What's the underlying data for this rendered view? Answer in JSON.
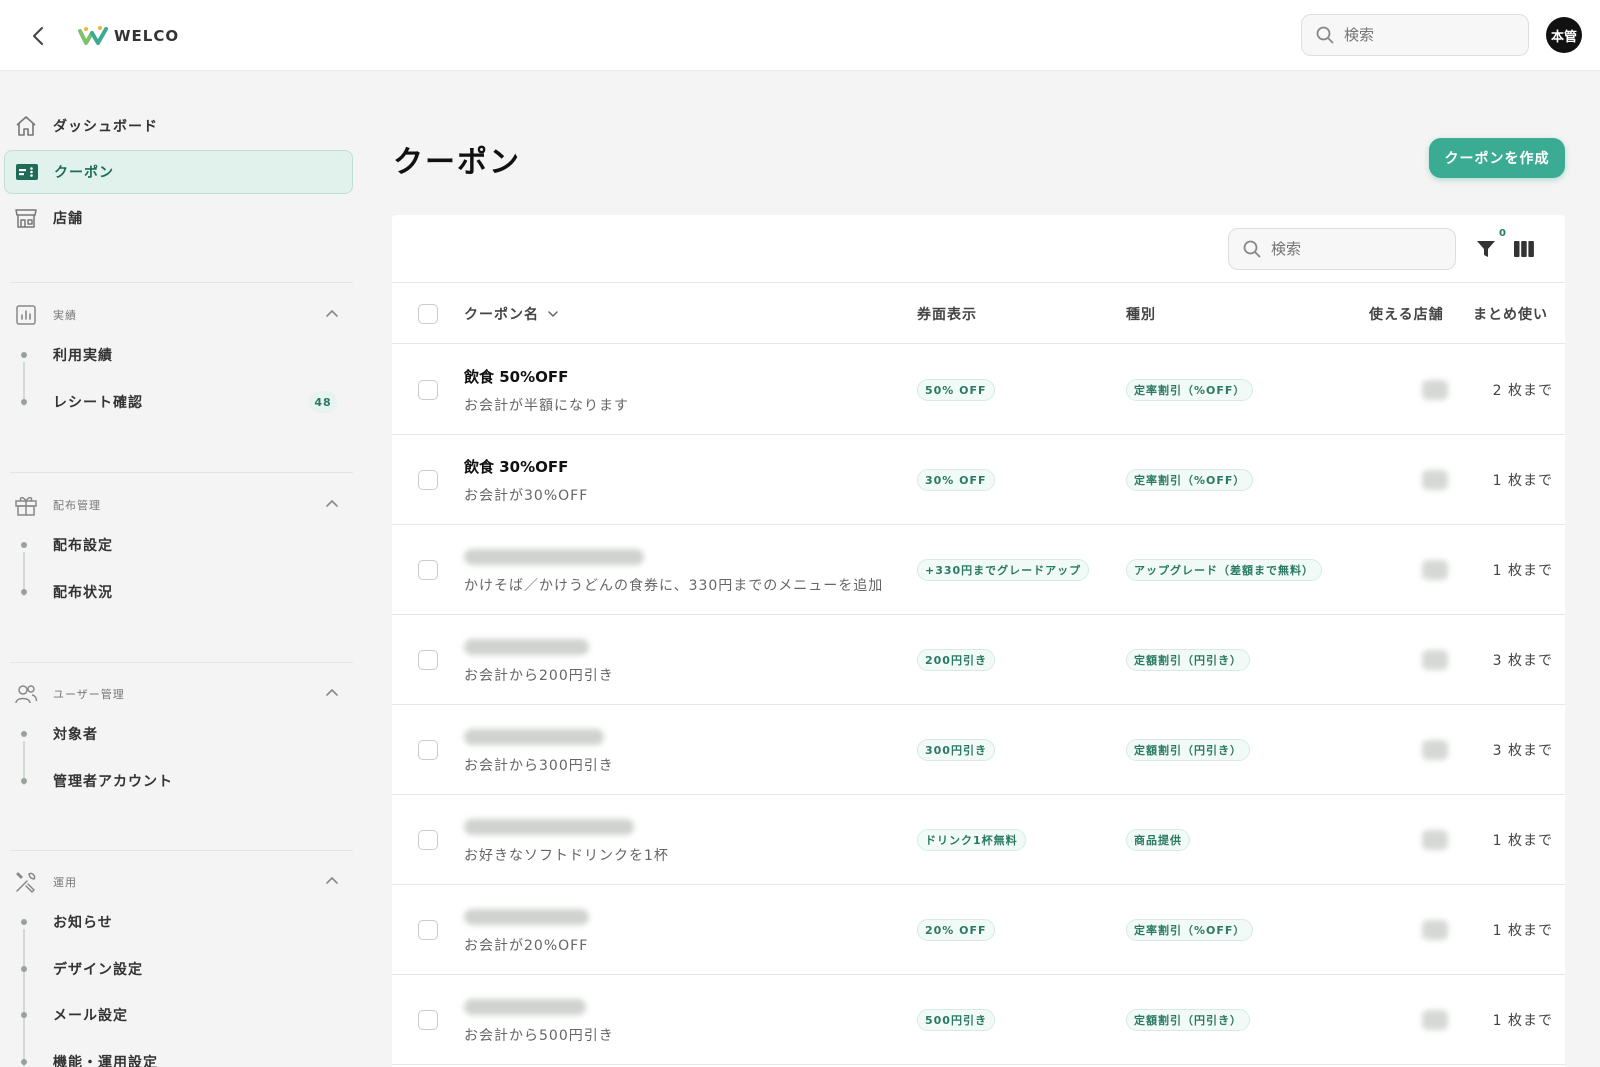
{
  "header": {
    "logo_text": "WELCO",
    "search_placeholder": "検索",
    "avatar_text": "本管"
  },
  "sidebar": {
    "top_items": [
      {
        "label": "ダッシュボード",
        "icon": "home-icon"
      },
      {
        "label": "クーポン",
        "icon": "ticket-icon",
        "active": true
      },
      {
        "label": "店舗",
        "icon": "store-icon"
      }
    ],
    "sections": [
      {
        "title": "実績",
        "icon": "chart-icon",
        "items": [
          {
            "label": "利用実績"
          },
          {
            "label": "レシート確認",
            "badge": "48"
          }
        ]
      },
      {
        "title": "配布管理",
        "icon": "gift-icon",
        "items": [
          {
            "label": "配布設定"
          },
          {
            "label": "配布状況"
          }
        ]
      },
      {
        "title": "ユーザー管理",
        "icon": "users-icon",
        "items": [
          {
            "label": "対象者"
          },
          {
            "label": "管理者アカウント"
          }
        ]
      },
      {
        "title": "運用",
        "icon": "tools-icon",
        "items": [
          {
            "label": "お知らせ"
          },
          {
            "label": "デザイン設定"
          },
          {
            "label": "メール設定"
          },
          {
            "label": "機能・運用設定"
          }
        ]
      }
    ]
  },
  "main": {
    "title": "クーポン",
    "create_button": "クーポンを作成",
    "search_placeholder": "検索",
    "filter_count": "0",
    "columns": {
      "name": "クーポン名",
      "face": "券面表示",
      "type": "種別",
      "stores": "使える店舗",
      "bulk": "まとめ使い"
    },
    "rows": [
      {
        "name": "飲食 50%OFF",
        "desc": "お会計が半額になります",
        "face": "50% OFF",
        "type": "定率割引（%OFF）",
        "limit": "2 枚まで"
      },
      {
        "name": "飲食 30%OFF",
        "desc": "お会計が30%OFF",
        "face": "30% OFF",
        "type": "定率割引（%OFF）",
        "limit": "1 枚まで"
      },
      {
        "name": "",
        "desc": "かけそば／かけうどんの食券に、330円までのメニューを追加",
        "face": "+330円までグレードアップ",
        "type": "アップグレード（差額まで無料）",
        "limit": "1 枚まで"
      },
      {
        "name": "",
        "desc": "お会計から200円引き",
        "face": "200円引き",
        "type": "定額割引（円引き）",
        "limit": "3 枚まで"
      },
      {
        "name": "",
        "desc": "お会計から300円引き",
        "face": "300円引き",
        "type": "定額割引（円引き）",
        "limit": "3 枚まで"
      },
      {
        "name": "",
        "desc": "お好きなソフトドリンクを1杯",
        "face": "ドリンク1杯無料",
        "type": "商品提供",
        "limit": "1 枚まで"
      },
      {
        "name": "",
        "desc": "お会計が20%OFF",
        "face": "20% OFF",
        "type": "定率割引（%OFF）",
        "limit": "1 枚まで"
      },
      {
        "name": "",
        "desc": "お会計から500円引き",
        "face": "500円引き",
        "type": "定額割引（円引き）",
        "limit": "1 枚まで"
      }
    ]
  },
  "colors": {
    "accent": "#3bab93",
    "accent_dark": "#1e6b57",
    "active_bg": "#e1f1ec"
  }
}
